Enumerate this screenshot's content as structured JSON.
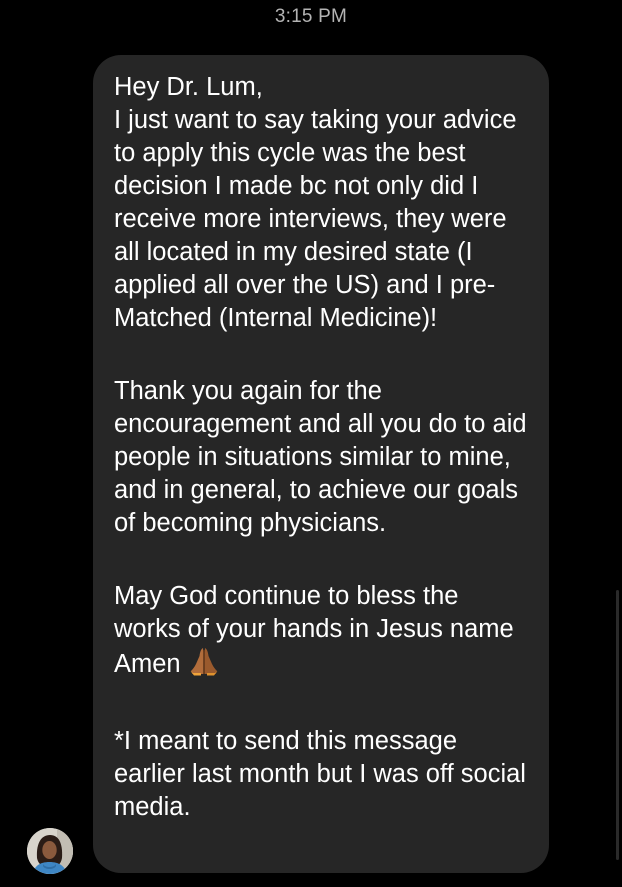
{
  "header": {
    "time": "3:15 PM"
  },
  "message": {
    "greeting": "Hey Dr. Lum,",
    "p1": "I just want to say taking your advice to apply this cycle was the best decision I made bc not only did I receive more interviews, they were all located in my desired state (I applied all over the US) and I pre-Matched (Internal Medicine)!",
    "p2": "Thank you again for the encouragement and all you do to aid people in situations similar to mine, and in general, to achieve our goals of becoming physicians.",
    "p3": "May God continue to bless the works of your hands in Jesus name Amen",
    "p3_emoji": "praying-hands-icon",
    "p4": "*I meant to send this message earlier last month but I was off social media."
  },
  "colors": {
    "background": "#000000",
    "bubble": "#262626",
    "timestamp": "#b4b4b4",
    "text": "#ffffff"
  },
  "sender": {
    "avatar_icon": "avatar-photo"
  }
}
